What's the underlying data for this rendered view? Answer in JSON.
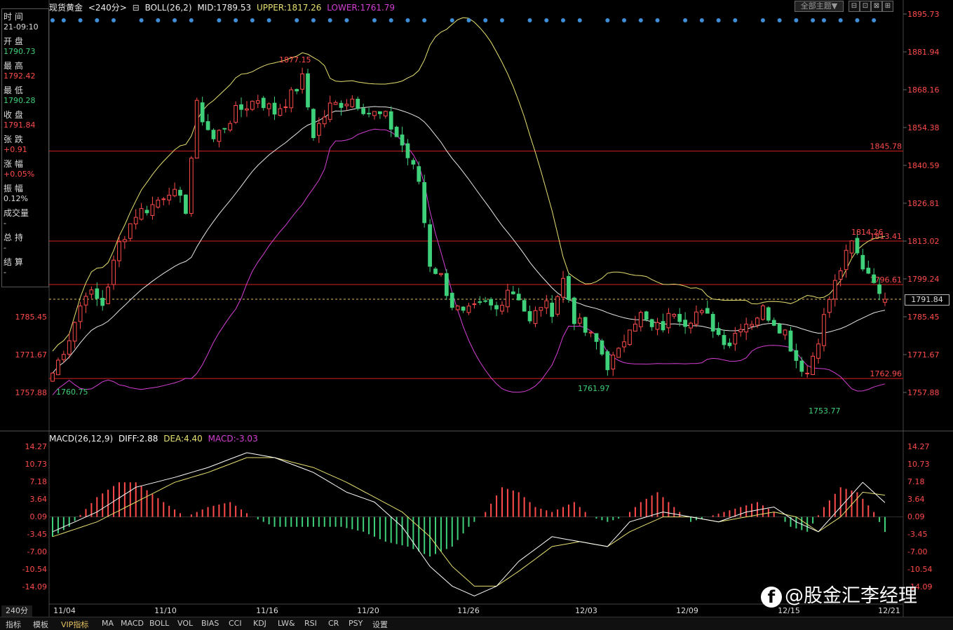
{
  "header": {
    "instrument": "现货黄金",
    "period": "<240分>",
    "indicator": "BOLL(26,2)",
    "mid": "MID:1789.53",
    "upper": "UPPER:1817.26",
    "lower": "LOWER:1761.79"
  },
  "toolbar": {
    "theme_label": "全部主题▼",
    "buttons": [
      "⊟",
      "⊡",
      "⊠",
      "⊞"
    ]
  },
  "info_panel": {
    "rows": [
      {
        "label": "时 间",
        "value": "21-09:10",
        "color": "#dddddd"
      },
      {
        "label": "开 盘",
        "value": "1790.73",
        "color": "#3fd07a"
      },
      {
        "label": "最 高",
        "value": "1792.42",
        "color": "#ff4b4b"
      },
      {
        "label": "最 低",
        "value": "1790.28",
        "color": "#3fd07a"
      },
      {
        "label": "收 盘",
        "value": "1791.84",
        "color": "#ff4b4b"
      },
      {
        "label": "张 跌",
        "value": "+0.91",
        "color": "#ff4b4b"
      },
      {
        "label": "涨 幅",
        "value": "+0.05%",
        "color": "#ff4b4b"
      },
      {
        "label": "振 幅",
        "value": "0.12%",
        "color": "#dddddd"
      },
      {
        "label": "成交量",
        "value": "-",
        "color": "#dddddd"
      },
      {
        "label": "总 持",
        "value": "-",
        "color": "#dddddd"
      },
      {
        "label": "结 算",
        "value": "-",
        "color": "#dddddd"
      }
    ]
  },
  "last_price": "1791.84",
  "macd_header": {
    "name": "MACD(26,12,9)",
    "diff": "DIFF:2.88",
    "dea": "DEA:4.40",
    "macd": "MACD:-3.03"
  },
  "period_label": "240分",
  "bottom_tabs": [
    "指标",
    "模板",
    "VIP指标",
    "MA",
    "MACD",
    "BOLL",
    "VOL",
    "BIAS",
    "CCI",
    "KDJ",
    "LW&",
    "RSI",
    "CR",
    "PSY",
    "设置"
  ],
  "watermark": "@股金汇李经理",
  "watermark_icon": "f",
  "colors": {
    "up": "#ff4b4b",
    "down": "#3fd07a",
    "boll_upper": "#e6e070",
    "boll_mid": "#e8e8e8",
    "boll_lower": "#d43fd4",
    "diff": "#ffffff",
    "dea": "#e6e070",
    "hline": "#d42020",
    "signal_dot": "#3f8fd8"
  },
  "chart_data": [
    {
      "type": "candlestick",
      "title": "现货黄金 240分",
      "x_tick_labels": [
        "11/04",
        "11/10",
        "11/16",
        "11/20",
        "11/26",
        "12/03",
        "12/09",
        "12/15",
        "12/21"
      ],
      "y_tick_labels": [
        "1895.73",
        "1881.94",
        "1868.16",
        "1854.38",
        "1840.59",
        "1826.81",
        "1813.02",
        "1799.24",
        "1785.45",
        "1771.67",
        "1757.88"
      ],
      "ylim": [
        1751.5,
        1897.6
      ],
      "annotations": [
        {
          "text": "1877.15",
          "value": 1877.15,
          "color": "#ff4b4b"
        },
        {
          "text": "1760.75",
          "value": 1760.75,
          "color": "#3fd07a"
        },
        {
          "text": "1761.97",
          "value": 1761.97,
          "color": "#3fd07a"
        },
        {
          "text": "1753.77",
          "value": 1753.77,
          "color": "#3fd07a"
        },
        {
          "text": "1814.26",
          "value": 1814.26,
          "color": "#ff4b4b"
        }
      ],
      "horizontal_lines": [
        {
          "text": "1845.78",
          "value": 1845.78
        },
        {
          "text": "1813.41",
          "value": 1813.02
        },
        {
          "text": "1796.61",
          "value": 1797.2
        },
        {
          "text": "1762.96",
          "value": 1762.96
        }
      ],
      "last_close": 1791.84,
      "close_series_keypoints": [
        [
          0,
          1765
        ],
        [
          3,
          1778
        ],
        [
          6,
          1795
        ],
        [
          9,
          1790
        ],
        [
          12,
          1812
        ],
        [
          15,
          1823
        ],
        [
          18,
          1826
        ],
        [
          21,
          1832
        ],
        [
          24,
          1825
        ],
        [
          26,
          1862
        ],
        [
          29,
          1850
        ],
        [
          33,
          1860
        ],
        [
          37,
          1865
        ],
        [
          40,
          1860
        ],
        [
          43,
          1866
        ],
        [
          45,
          1872
        ],
        [
          47,
          1852
        ],
        [
          50,
          1862
        ],
        [
          54,
          1865
        ],
        [
          57,
          1860
        ],
        [
          60,
          1858
        ],
        [
          63,
          1848
        ],
        [
          66,
          1835
        ],
        [
          68,
          1805
        ],
        [
          70,
          1800
        ],
        [
          72,
          1790
        ],
        [
          74,
          1786
        ],
        [
          76,
          1788
        ],
        [
          78,
          1790
        ],
        [
          80,
          1788
        ],
        [
          82,
          1796
        ],
        [
          84,
          1793
        ],
        [
          86,
          1783
        ],
        [
          88,
          1790
        ],
        [
          90,
          1788
        ],
        [
          92,
          1799
        ],
        [
          94,
          1785
        ],
        [
          96,
          1780
        ],
        [
          98,
          1776
        ],
        [
          100,
          1768
        ],
        [
          102,
          1772
        ],
        [
          104,
          1783
        ],
        [
          106,
          1786
        ],
        [
          108,
          1781
        ],
        [
          110,
          1782
        ],
        [
          112,
          1788
        ],
        [
          114,
          1784
        ],
        [
          116,
          1787
        ],
        [
          118,
          1785
        ],
        [
          120,
          1779
        ],
        [
          122,
          1776
        ],
        [
          124,
          1783
        ],
        [
          126,
          1784
        ],
        [
          128,
          1788
        ],
        [
          130,
          1784
        ],
        [
          132,
          1780
        ],
        [
          134,
          1770
        ],
        [
          136,
          1765
        ],
        [
          138,
          1778
        ],
        [
          140,
          1792
        ],
        [
          142,
          1803
        ],
        [
          144,
          1812
        ],
        [
          146,
          1804
        ],
        [
          148,
          1800
        ],
        [
          149,
          1792
        ],
        [
          150,
          1791.84
        ]
      ],
      "signal_dot_count": 45
    },
    {
      "type": "bar",
      "title": "MACD(26,12,9)",
      "y_tick_labels": [
        "14.27",
        "10.73",
        "7.18",
        "3.64",
        "0.09",
        "-3.45",
        "-7.00",
        "-10.54",
        "-14.09"
      ],
      "ylim": [
        -18.5,
        15.2
      ],
      "series": [
        {
          "name": "DIFF",
          "keypoints": [
            [
              0,
              -3
            ],
            [
              8,
              1
            ],
            [
              15,
              6
            ],
            [
              22,
              8
            ],
            [
              28,
              10
            ],
            [
              35,
              13
            ],
            [
              40,
              12
            ],
            [
              47,
              9
            ],
            [
              53,
              5
            ],
            [
              58,
              3
            ],
            [
              63,
              -2
            ],
            [
              68,
              -10
            ],
            [
              72,
              -14
            ],
            [
              76,
              -16
            ],
            [
              80,
              -14
            ],
            [
              84,
              -9
            ],
            [
              90,
              -4
            ],
            [
              95,
              -5
            ],
            [
              100,
              -6
            ],
            [
              104,
              -1
            ],
            [
              110,
              1
            ],
            [
              115,
              0
            ],
            [
              120,
              -1
            ],
            [
              125,
              1
            ],
            [
              130,
              2
            ],
            [
              134,
              -1
            ],
            [
              138,
              -3
            ],
            [
              142,
              2
            ],
            [
              146,
              7
            ],
            [
              150,
              2.88
            ]
          ]
        },
        {
          "name": "DEA",
          "keypoints": [
            [
              0,
              -4
            ],
            [
              8,
              -1
            ],
            [
              15,
              3
            ],
            [
              22,
              7
            ],
            [
              28,
              9
            ],
            [
              35,
              12
            ],
            [
              40,
              12
            ],
            [
              47,
              10
            ],
            [
              53,
              7
            ],
            [
              58,
              4
            ],
            [
              63,
              1
            ],
            [
              68,
              -4
            ],
            [
              72,
              -10
            ],
            [
              76,
              -14
            ],
            [
              80,
              -14
            ],
            [
              84,
              -11
            ],
            [
              90,
              -6
            ],
            [
              95,
              -5
            ],
            [
              100,
              -6
            ],
            [
              104,
              -3
            ],
            [
              110,
              0
            ],
            [
              115,
              0
            ],
            [
              120,
              -1
            ],
            [
              125,
              0
            ],
            [
              130,
              1
            ],
            [
              134,
              0
            ],
            [
              138,
              -3
            ],
            [
              142,
              0
            ],
            [
              146,
              5
            ],
            [
              150,
              4.4
            ]
          ]
        },
        {
          "name": "MACD",
          "keypoints": [
            [
              0,
              -4
            ],
            [
              3,
              -2
            ],
            [
              8,
              4
            ],
            [
              12,
              7
            ],
            [
              15,
              7
            ],
            [
              20,
              3
            ],
            [
              24,
              0
            ],
            [
              28,
              2
            ],
            [
              32,
              3
            ],
            [
              36,
              0
            ],
            [
              40,
              -2
            ],
            [
              46,
              -2
            ],
            [
              52,
              -2
            ],
            [
              56,
              -3
            ],
            [
              60,
              -5
            ],
            [
              64,
              -6
            ],
            [
              68,
              -8
            ],
            [
              72,
              -6
            ],
            [
              75,
              -2
            ],
            [
              78,
              1
            ],
            [
              81,
              6
            ],
            [
              84,
              5
            ],
            [
              87,
              2
            ],
            [
              90,
              1
            ],
            [
              94,
              3
            ],
            [
              97,
              0
            ],
            [
              100,
              -1
            ],
            [
              103,
              0
            ],
            [
              106,
              3
            ],
            [
              109,
              5
            ],
            [
              112,
              2
            ],
            [
              115,
              -1
            ],
            [
              118,
              0
            ],
            [
              121,
              1
            ],
            [
              124,
              2
            ],
            [
              127,
              3
            ],
            [
              130,
              1
            ],
            [
              133,
              -2
            ],
            [
              136,
              -3
            ],
            [
              139,
              2
            ],
            [
              142,
              6
            ],
            [
              145,
              5
            ],
            [
              148,
              1
            ],
            [
              150,
              -3.03
            ]
          ]
        }
      ]
    }
  ]
}
